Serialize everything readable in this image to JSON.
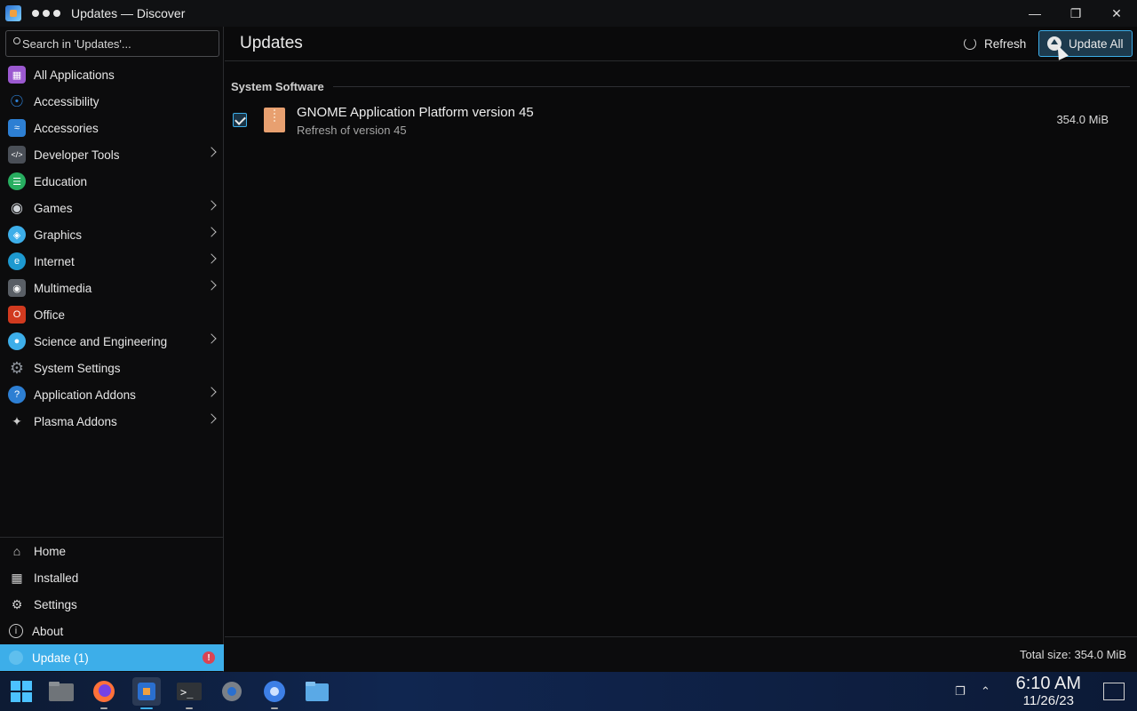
{
  "window": {
    "title": "Updates — Discover",
    "controls": [
      "minimize-icon",
      "maximize-icon",
      "close-icon"
    ]
  },
  "search": {
    "placeholder": "Search in 'Updates'..."
  },
  "categories": [
    {
      "label": "All Applications",
      "icon": "all-applications-icon",
      "color": "#9b59d0",
      "chevron": false
    },
    {
      "label": "Accessibility",
      "icon": "accessibility-icon",
      "color": "#2d7fd3",
      "chevron": false
    },
    {
      "label": "Accessories",
      "icon": "accessories-icon",
      "color": "#2d7fd3",
      "chevron": false
    },
    {
      "label": "Developer Tools",
      "icon": "developer-tools-icon",
      "color": "#4a4f57",
      "chevron": true
    },
    {
      "label": "Education",
      "icon": "education-icon",
      "color": "#27ae60",
      "chevron": false
    },
    {
      "label": "Games",
      "icon": "games-icon",
      "color": "#cfd3d8",
      "chevron": true
    },
    {
      "label": "Graphics",
      "icon": "graphics-icon",
      "color": "#3daee9",
      "chevron": true
    },
    {
      "label": "Internet",
      "icon": "internet-icon",
      "color": "#1d99d0",
      "chevron": true
    },
    {
      "label": "Multimedia",
      "icon": "multimedia-icon",
      "color": "#5a5f66",
      "chevron": true
    },
    {
      "label": "Office",
      "icon": "office-icon",
      "color": "#d13a1f",
      "chevron": false
    },
    {
      "label": "Science and Engineering",
      "icon": "science-icon",
      "color": "#3daee9",
      "chevron": true
    },
    {
      "label": "System Settings",
      "icon": "system-settings-icon",
      "color": "#8c929a",
      "chevron": false
    },
    {
      "label": "Application Addons",
      "icon": "application-addons-icon",
      "color": "#2d7fd3",
      "chevron": true
    },
    {
      "label": "Plasma Addons",
      "icon": "plasma-addons-icon",
      "color": "#cccccc",
      "chevron": true
    }
  ],
  "bottom_nav": [
    {
      "label": "Home",
      "icon": "home-icon"
    },
    {
      "label": "Installed",
      "icon": "installed-icon"
    },
    {
      "label": "Settings",
      "icon": "settings-icon"
    },
    {
      "label": "About",
      "icon": "about-icon"
    },
    {
      "label": "Update (1)",
      "icon": "update-icon",
      "active": true,
      "badge": "!"
    }
  ],
  "header": {
    "title": "Updates",
    "refresh_label": "Refresh",
    "update_all_label": "Update All"
  },
  "section": {
    "label": "System Software"
  },
  "updates": [
    {
      "name": "GNOME Application Platform version 45",
      "description": "Refresh of version 45",
      "size": "354.0 MiB",
      "checked": true
    }
  ],
  "footer": {
    "total": "Total size: 354.0 MiB"
  },
  "taskbar": {
    "apps": [
      "windows-start-icon",
      "file-manager-icon",
      "firefox-icon",
      "discover-icon",
      "terminal-icon",
      "settings-icon",
      "chromium-icon",
      "files-icon"
    ],
    "time": "6:10 AM",
    "date": "11/26/23"
  },
  "colors": {
    "accent": "#3daee9",
    "badge": "#da4453",
    "background": "#0a0a0b"
  }
}
